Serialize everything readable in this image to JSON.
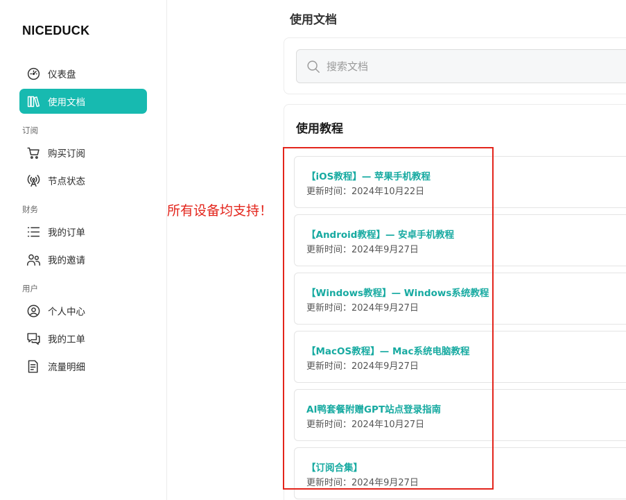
{
  "brand": "NICEDUCK",
  "sidebar": {
    "items": [
      {
        "label": "仪表盘",
        "icon": "dashboard-icon"
      },
      {
        "label": "使用文档",
        "icon": "books-icon",
        "active": true
      },
      {
        "label": "购买订阅",
        "icon": "cart-icon"
      },
      {
        "label": "节点状态",
        "icon": "antenna-icon"
      },
      {
        "label": "我的订单",
        "icon": "list-icon"
      },
      {
        "label": "我的邀请",
        "icon": "users-icon"
      },
      {
        "label": "个人中心",
        "icon": "user-circle-icon"
      },
      {
        "label": "我的工单",
        "icon": "chat-icon"
      },
      {
        "label": "流量明细",
        "icon": "document-icon"
      }
    ],
    "groups": {
      "subscription": "订阅",
      "finance": "财务",
      "user": "用户"
    }
  },
  "main": {
    "page_title": "使用文档",
    "search": {
      "placeholder": "搜索文档",
      "value": ""
    },
    "section_title": "使用教程",
    "docs": [
      {
        "title": "【iOS教程】— 苹果手机教程",
        "date": "更新时间：2024年10月22日"
      },
      {
        "title": "【Android教程】— 安卓手机教程",
        "date": "更新时间：2024年9月27日"
      },
      {
        "title": "【Windows教程】— Windows系统教程",
        "date": "更新时间：2024年9月27日"
      },
      {
        "title": "【MacOS教程】— Mac系统电脑教程",
        "date": "更新时间：2024年9月27日"
      },
      {
        "title": "AI鸭套餐附赠GPT站点登录指南",
        "date": "更新时间：2024年10月27日"
      },
      {
        "title": "【订阅合集】",
        "date": "更新时间：2024年9月27日"
      }
    ]
  },
  "annotation": {
    "text": "所有设备均支持！",
    "color": "#e3241b"
  },
  "colors": {
    "accent": "#17bab0",
    "link": "#17aaa1"
  }
}
